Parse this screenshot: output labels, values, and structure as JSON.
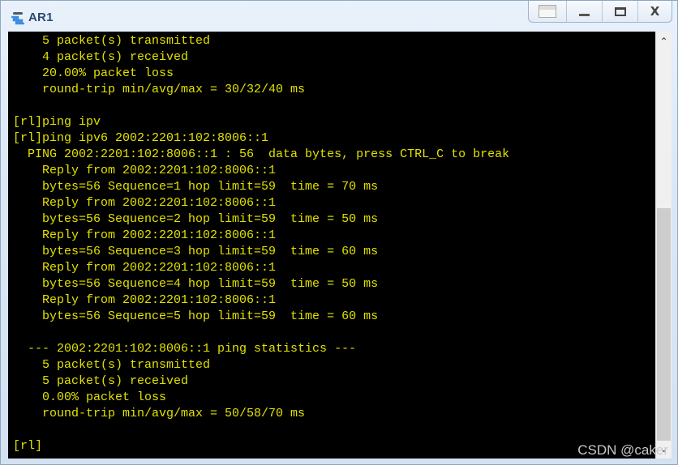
{
  "window": {
    "title": "AR1",
    "app_icon": "router-icon",
    "controls": {
      "restore_icon": "window-layout-icon",
      "minimize_label": "_",
      "maximize_icon": "maximize-icon",
      "close_label": "X"
    }
  },
  "terminal": {
    "text_color": "#e1e100",
    "background_color": "#000000",
    "lines": [
      "    5 packet(s) transmitted",
      "    4 packet(s) received",
      "    20.00% packet loss",
      "    round-trip min/avg/max = 30/32/40 ms",
      "",
      "[rl]ping ipv",
      "[rl]ping ipv6 2002:2201:102:8006::1",
      "  PING 2002:2201:102:8006::1 : 56  data bytes, press CTRL_C to break",
      "    Reply from 2002:2201:102:8006::1",
      "    bytes=56 Sequence=1 hop limit=59  time = 70 ms",
      "    Reply from 2002:2201:102:8006::1",
      "    bytes=56 Sequence=2 hop limit=59  time = 50 ms",
      "    Reply from 2002:2201:102:8006::1",
      "    bytes=56 Sequence=3 hop limit=59  time = 60 ms",
      "    Reply from 2002:2201:102:8006::1",
      "    bytes=56 Sequence=4 hop limit=59  time = 50 ms",
      "    Reply from 2002:2201:102:8006::1",
      "    bytes=56 Sequence=5 hop limit=59  time = 60 ms",
      "",
      "  --- 2002:2201:102:8006::1 ping statistics ---",
      "    5 packet(s) transmitted",
      "    5 packet(s) received",
      "    0.00% packet loss",
      "    round-trip min/avg/max = 50/58/70 ms",
      "",
      "[rl]"
    ]
  },
  "scrollbar": {
    "up_glyph": "⌃",
    "down_glyph": "⌄",
    "position_fraction": 0.45
  },
  "watermark": "CSDN @caker"
}
